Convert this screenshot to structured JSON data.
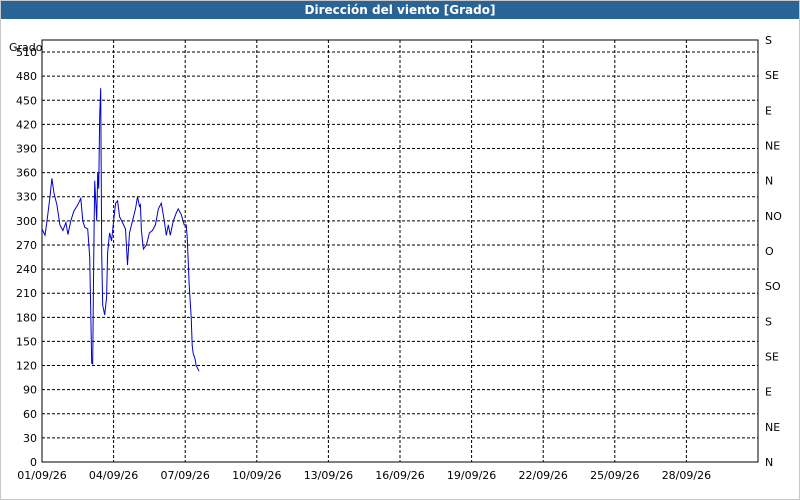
{
  "window": {
    "title": "Dirección del viento [Grado]"
  },
  "chart_data": {
    "type": "line",
    "title": "Dirección del viento [Grado]",
    "ylabel": "Grado",
    "xlim": [
      "01/09/26",
      "31/09/26"
    ],
    "ylim": [
      0,
      525
    ],
    "grid": true,
    "y_ticks": [
      0,
      30,
      60,
      90,
      120,
      150,
      180,
      210,
      240,
      270,
      300,
      330,
      360,
      390,
      420,
      450,
      480,
      510
    ],
    "x_ticks": [
      "01/09/26",
      "04/09/26",
      "07/09/26",
      "10/09/26",
      "13/09/26",
      "16/09/26",
      "19/09/26",
      "22/09/26",
      "25/09/26",
      "28/09/26"
    ],
    "right_ticks": [
      {
        "label": "N",
        "value": 0
      },
      {
        "label": "NE",
        "value": 45
      },
      {
        "label": "E",
        "value": 90
      },
      {
        "label": "SE",
        "value": 135
      },
      {
        "label": "S",
        "value": 180
      },
      {
        "label": "SO",
        "value": 225
      },
      {
        "label": "O",
        "value": 270
      },
      {
        "label": "NO",
        "value": 315
      },
      {
        "label": "N",
        "value": 360
      },
      {
        "label": "NE",
        "value": 405
      },
      {
        "label": "E",
        "value": 450
      },
      {
        "label": "SE",
        "value": 495
      },
      {
        "label": "S",
        "value": 540
      }
    ],
    "line_color": "#0000cc",
    "series": [
      {
        "name": "",
        "values": [
          [
            "01/09/26 00:00",
            290
          ],
          [
            "01/09/26 03:00",
            282
          ],
          [
            "01/09/26 05:00",
            300
          ],
          [
            "01/09/26 08:00",
            330
          ],
          [
            "01/09/26 10:00",
            353
          ],
          [
            "01/09/26 12:00",
            335
          ],
          [
            "01/09/26 15:00",
            320
          ],
          [
            "01/09/26 18:00",
            295
          ],
          [
            "01/09/26 21:00",
            288
          ],
          [
            "02/09/26 00:00",
            298
          ],
          [
            "02/09/26 02:00",
            283
          ],
          [
            "02/09/26 05:00",
            300
          ],
          [
            "02/09/26 08:00",
            312
          ],
          [
            "02/09/26 12:00",
            320
          ],
          [
            "02/09/26 15:00",
            328
          ],
          [
            "02/09/26 17:00",
            300
          ],
          [
            "02/09/26 19:00",
            292
          ],
          [
            "02/09/26 22:00",
            290
          ],
          [
            "03/09/26 00:00",
            255
          ],
          [
            "03/09/26 01:00",
            190
          ],
          [
            "03/09/26 02:00",
            123
          ],
          [
            "03/09/26 03:00",
            122
          ],
          [
            "03/09/26 04:00",
            250
          ],
          [
            "03/09/26 05:00",
            350
          ],
          [
            "03/09/26 07:00",
            300
          ],
          [
            "03/09/26 08:00",
            360
          ],
          [
            "03/09/26 09:00",
            340
          ],
          [
            "03/09/26 10:00",
            430
          ],
          [
            "03/09/26 11:00",
            465
          ],
          [
            "03/09/26 12:00",
            260
          ],
          [
            "03/09/26 13:00",
            195
          ],
          [
            "03/09/26 15:00",
            183
          ],
          [
            "03/09/26 17:00",
            205
          ],
          [
            "03/09/26 18:00",
            260
          ],
          [
            "03/09/26 20:00",
            285
          ],
          [
            "03/09/26 22:00",
            275
          ],
          [
            "04/09/26 00:00",
            300
          ],
          [
            "04/09/26 02:00",
            322
          ],
          [
            "04/09/26 04:00",
            325
          ],
          [
            "04/09/26 06:00",
            305
          ],
          [
            "04/09/26 09:00",
            298
          ],
          [
            "04/09/26 12:00",
            290
          ],
          [
            "04/09/26 14:00",
            245
          ],
          [
            "04/09/26 16:00",
            285
          ],
          [
            "04/09/26 19:00",
            300
          ],
          [
            "04/09/26 22:00",
            315
          ],
          [
            "05/09/26 00:00",
            330
          ],
          [
            "05/09/26 02:00",
            318
          ],
          [
            "05/09/26 03:00",
            320
          ],
          [
            "05/09/26 04:00",
            288
          ],
          [
            "05/09/26 06:00",
            265
          ],
          [
            "05/09/26 09:00",
            270
          ],
          [
            "05/09/26 12:00",
            285
          ],
          [
            "05/09/26 15:00",
            288
          ],
          [
            "05/09/26 18:00",
            295
          ],
          [
            "05/09/26 21:00",
            315
          ],
          [
            "06/09/26 00:00",
            322
          ],
          [
            "06/09/26 03:00",
            300
          ],
          [
            "06/09/26 05:00",
            282
          ],
          [
            "06/09/26 07:00",
            295
          ],
          [
            "06/09/26 09:00",
            282
          ],
          [
            "06/09/26 12:00",
            300
          ],
          [
            "06/09/26 15:00",
            310
          ],
          [
            "06/09/26 17:00",
            315
          ],
          [
            "06/09/26 20:00",
            308
          ],
          [
            "06/09/26 23:00",
            295
          ],
          [
            "07/09/26 01:00",
            295
          ],
          [
            "07/09/26 02:00",
            280
          ],
          [
            "07/09/26 04:00",
            220
          ],
          [
            "07/09/26 06:00",
            180
          ],
          [
            "07/09/26 07:00",
            145
          ],
          [
            "07/09/26 08:00",
            135
          ],
          [
            "07/09/26 10:00",
            128
          ],
          [
            "07/09/26 11:00",
            120
          ],
          [
            "07/09/26 14:00",
            113
          ]
        ]
      }
    ]
  }
}
